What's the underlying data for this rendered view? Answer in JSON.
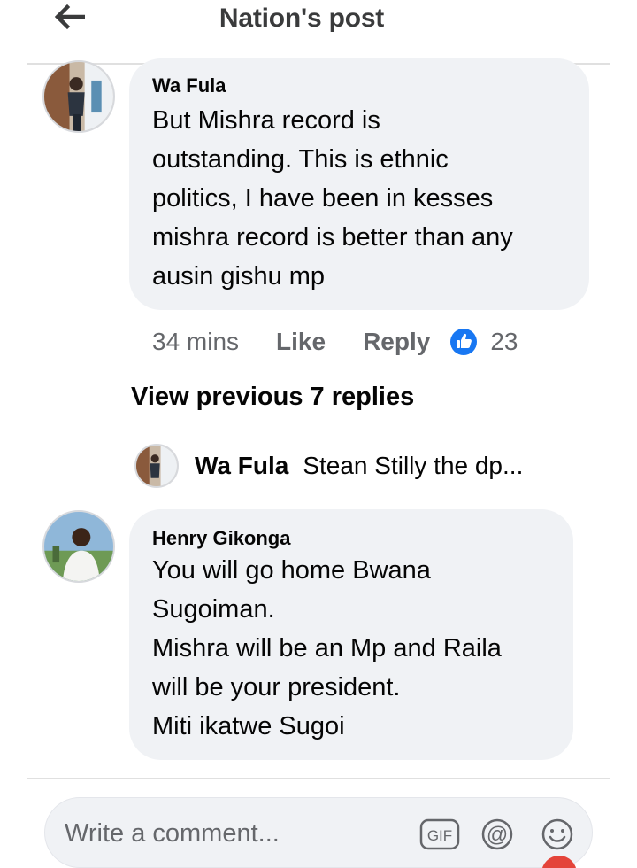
{
  "header": {
    "title": "Nation's post",
    "back_icon": "arrow-left-icon"
  },
  "comments": [
    {
      "author": "Wa Fula",
      "lines": [
        "But Mishra record is",
        "outstanding. This is ethnic",
        "politics, I have been in kesses",
        "mishra record is better than any",
        "ausin gishu mp"
      ],
      "time": "34 mins",
      "like_label": "Like",
      "reply_label": "Reply",
      "reaction_icon": "thumbs-up-icon",
      "reaction_count": "23"
    },
    {
      "author": "Henry Gikonga",
      "lines": [
        "You will go home Bwana",
        "Sugoiman.",
        "Mishra will be an Mp and Raila",
        "will be your president.",
        "Miti ikatwe Sugoi"
      ]
    }
  ],
  "view_previous": "View previous 7 replies",
  "collapsed_reply": {
    "author": "Wa Fula",
    "snippet": "Stean Stilly the dp..."
  },
  "composer": {
    "placeholder": "Write a comment...",
    "icons": [
      "gif-icon",
      "at-icon",
      "emoji-icon"
    ]
  },
  "colors": {
    "bubble": "#f0f2f5",
    "secondary_text": "#65676b",
    "like_blue": "#1877f2"
  }
}
